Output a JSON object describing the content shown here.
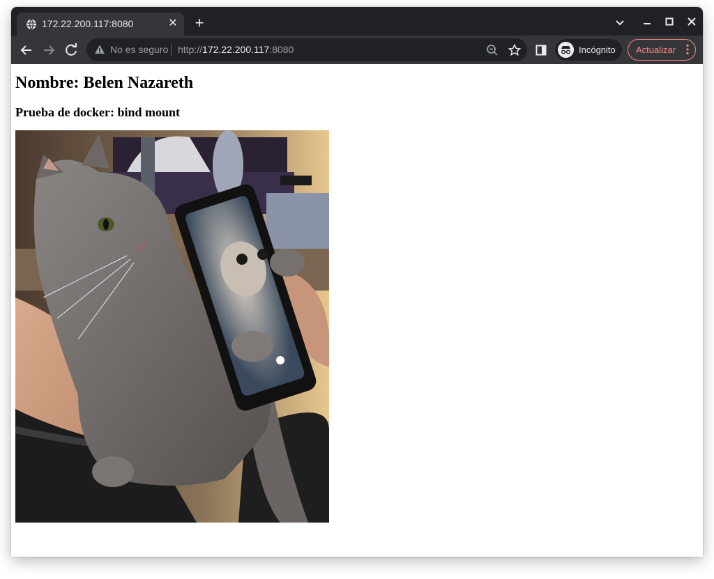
{
  "browser": {
    "tab": {
      "title": "172.22.200.117:8080",
      "favicon": "globe-icon"
    },
    "omnibox": {
      "security_text": "No es seguro",
      "url_scheme": "http://",
      "url_host": "172.22.200.117",
      "url_port": ":8080"
    },
    "profile_label": "Incógnito",
    "update_label": "Actualizar",
    "accent_color": "#f28b82"
  },
  "page": {
    "heading": "Nombre: Belen Nazareth",
    "subheading": "Prueba de docker: bind mount",
    "image_subject": "gray cat holding a smartphone showing a cat on screen"
  }
}
